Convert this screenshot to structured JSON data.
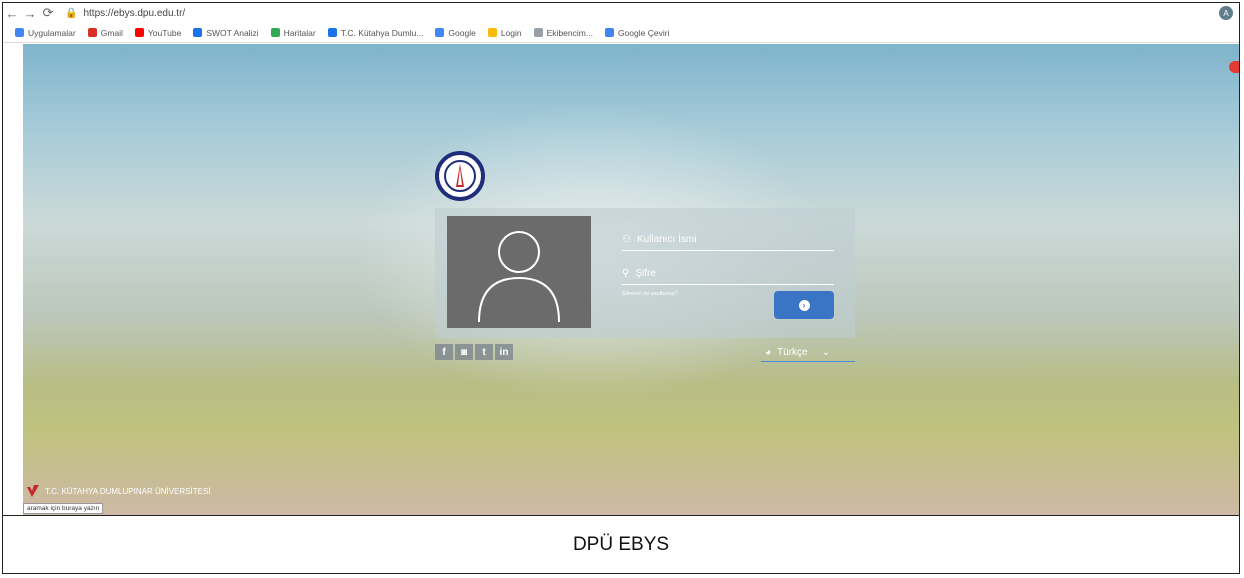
{
  "browser": {
    "url": "https://ebys.dpu.edu.tr/",
    "profile_letter": "A",
    "bookmarks": [
      {
        "label": "Uygulamalar",
        "color": "#4285f4"
      },
      {
        "label": "Gmail",
        "color": "#d93025"
      },
      {
        "label": "YouTube",
        "color": "#ff0000"
      },
      {
        "label": "SWOT Analizi",
        "color": "#1a73e8"
      },
      {
        "label": "Haritalar",
        "color": "#34a853"
      },
      {
        "label": "T.C. Kütahya Dumlu...",
        "color": "#1a73e8"
      },
      {
        "label": "Google",
        "color": "#4285f4"
      },
      {
        "label": "Login",
        "color": "#fbbc05"
      },
      {
        "label": "Ekibencim...",
        "color": "#9aa0a6"
      },
      {
        "label": "Google Çeviri",
        "color": "#4285f4"
      }
    ]
  },
  "login": {
    "username_placeholder": "Kullanıcı İsmi",
    "password_placeholder": "Şifre",
    "forgot_label": "Şifrenizi mi unuttunuz?",
    "language_label": "Türkçe"
  },
  "social": [
    "f",
    "◙",
    "t",
    "in"
  ],
  "footer": {
    "university_name": "T.C. KÜTAHYA DUMLUPINAR ÜNİVERSİTESİ",
    "tooltip_text": "aramak için buraya yazın"
  },
  "caption": "DPÜ EBYS",
  "colors": {
    "accent": "#3a74c4",
    "logo_blue": "#1f2e7a",
    "avatar_bg": "#6b6b6b"
  }
}
